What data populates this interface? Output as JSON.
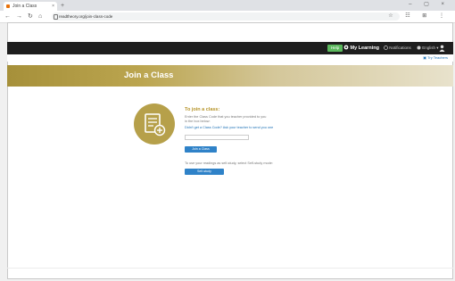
{
  "browser": {
    "tab_title": "Join a Class",
    "tab_close": "×",
    "new_tab": "+",
    "window_controls": "– ▢ ×",
    "nav": {
      "back": "←",
      "forward": "→",
      "reload": "↻",
      "home": "⌂"
    },
    "url": "readtheory.org/join-class-code",
    "tool_icons": "☆ ☷ ⊞ ⋮"
  },
  "site": {
    "help_label": "Help",
    "my_learning_label": "My Learning",
    "notifications_label": "Notifications",
    "language_label": "English ▾",
    "teacher_link": "Try Teachers",
    "banner_title": "Join a Class"
  },
  "join": {
    "heading": "To join a class:",
    "instructions_line1": "Enter the Class Code that you teacher provided to you",
    "instructions_line2": "in the box below:",
    "link_text": "Didn't get a Class Code? Ask your teacher to send you one",
    "input_placeholder": "",
    "join_button": "Join a Class",
    "self_study_note": "To use your readings as self-study, select Self-study mode:",
    "self_study_button": "Self-study"
  },
  "colors": {
    "accent_gold": "#b6a04a",
    "top_bar": "#1e1e1e",
    "button_blue": "#2f82c8",
    "help_green": "#5bb85d"
  }
}
